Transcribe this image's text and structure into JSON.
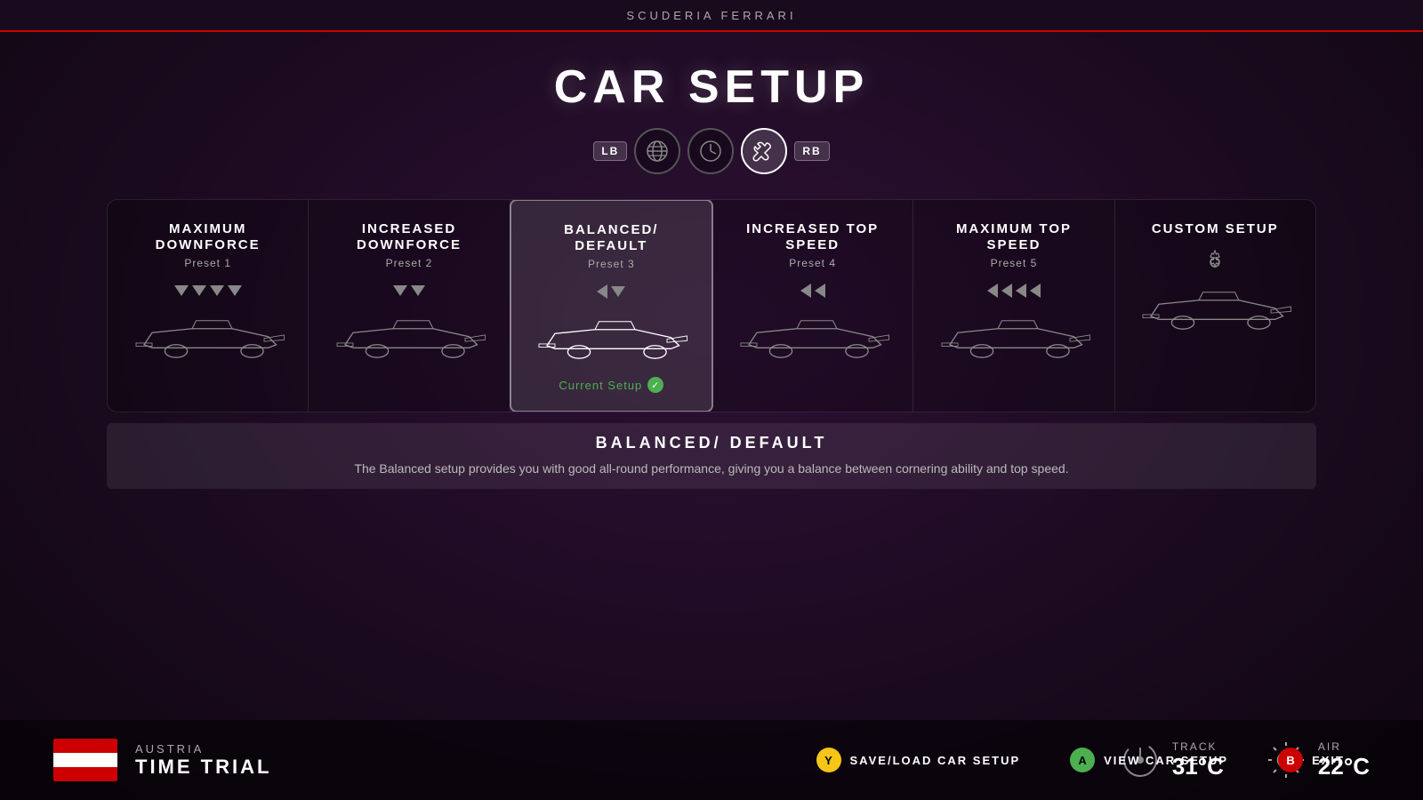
{
  "team": {
    "name": "SCUDERIA FERRARI"
  },
  "header": {
    "title": "CAR SETUP"
  },
  "tabs": [
    {
      "id": "lb",
      "label": "LB"
    },
    {
      "id": "globe",
      "icon": "🌐",
      "label": "globe-icon"
    },
    {
      "id": "clock",
      "icon": "⏱",
      "label": "clock-icon"
    },
    {
      "id": "tools",
      "icon": "🔧",
      "label": "tools-icon",
      "active": true
    },
    {
      "id": "rb",
      "label": "RB"
    }
  ],
  "presets": [
    {
      "id": "max-downforce",
      "title": "MAXIMUM DOWNFORCE",
      "subtitle": "Preset 1",
      "wings": [
        "down",
        "down",
        "down",
        "down"
      ],
      "active": false
    },
    {
      "id": "increased-downforce",
      "title": "INCREASED DOWNFORCE",
      "subtitle": "Preset 2",
      "wings": [
        "down",
        "down"
      ],
      "active": false
    },
    {
      "id": "balanced",
      "title": "BALANCED/ DEFAULT",
      "subtitle": "Preset 3",
      "wings": [
        "left",
        "down"
      ],
      "active": true,
      "currentSetup": true,
      "currentSetupLabel": "Current Setup"
    },
    {
      "id": "increased-top-speed",
      "title": "INCREASED TOP SPEED",
      "subtitle": "Preset 4",
      "wings": [
        "left",
        "left"
      ],
      "active": false
    },
    {
      "id": "max-top-speed",
      "title": "MAXIMUM TOP SPEED",
      "subtitle": "Preset 5",
      "wings": [
        "left",
        "left",
        "left",
        "left"
      ],
      "active": false
    },
    {
      "id": "custom-setup",
      "title": "CUSTOM SETUP",
      "subtitle": "",
      "wings": [],
      "gear": true,
      "active": false
    }
  ],
  "description": {
    "title": "BALANCED/ DEFAULT",
    "text": "The Balanced setup provides you with good all-round performance, giving you a balance between cornering ability and top speed."
  },
  "location": {
    "country": "AUSTRIA",
    "mode": "TIME TRIAL"
  },
  "weather": {
    "track": {
      "label": "TRACK",
      "value": "31°C"
    },
    "air": {
      "label": "AIR",
      "value": "22°C"
    }
  },
  "buttons": [
    {
      "id": "save-load",
      "circle": "Y",
      "color": "yellow",
      "label": "SAVE/LOAD CAR SETUP"
    },
    {
      "id": "view-car",
      "circle": "A",
      "color": "green",
      "label": "VIEW CAR SETUP"
    },
    {
      "id": "exit",
      "circle": "B",
      "color": "red",
      "label": "EXIT"
    }
  ]
}
